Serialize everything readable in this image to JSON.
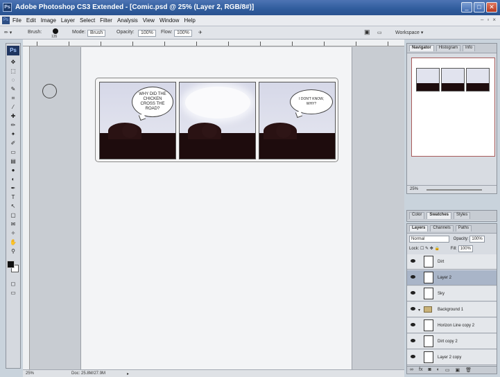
{
  "window": {
    "title": "Adobe Photoshop CS3 Extended - [Comic.psd @ 25% (Layer 2, RGB/8#)]",
    "app_icon": "Ps",
    "controls": [
      "_",
      "□",
      "✕"
    ]
  },
  "menubar": {
    "items": [
      "File",
      "Edit",
      "Image",
      "Layer",
      "Select",
      "Filter",
      "Analysis",
      "View",
      "Window",
      "Help"
    ],
    "doc_controls": [
      "–",
      "▫",
      "×"
    ]
  },
  "options_bar": {
    "brush_label": "Brush:",
    "brush_size": "135",
    "mode_label": "Mode:",
    "mode_value": "Brush",
    "opacity_label": "Opacity:",
    "opacity_value": "100%",
    "flow_label": "Flow:",
    "flow_value": "100%",
    "workspace_label": "Workspace ▾"
  },
  "toolbox": {
    "logo": "Ps",
    "tools": [
      "move-tool",
      "marquee-tool",
      "lasso-tool",
      "quick-select-tool",
      "crop-tool",
      "eyedropper-tool",
      "healing-tool",
      "brush-tool",
      "clone-tool",
      "history-brush-tool",
      "eraser-tool",
      "gradient-tool",
      "blur-tool",
      "dodge-tool",
      "pen-tool",
      "type-tool",
      "path-select-tool",
      "shape-tool",
      "notes-tool",
      "eyedropper-3d-tool",
      "hand-tool",
      "zoom-tool"
    ],
    "glyphs": [
      "✥",
      "⬚",
      "◌",
      "✎",
      "⌗",
      "⁄",
      "✚",
      "✏",
      "✦",
      "✐",
      "▭",
      "▤",
      "●",
      "◐",
      "✒",
      "T",
      "↖",
      "▢",
      "✉",
      "✧",
      "✋",
      "⚲"
    ]
  },
  "comic": {
    "panel1_bubble": "WHY DID THE CHICKEN CROSS THE ROAD?",
    "panel3_bubble": "I DON'T KNOW, WHY?"
  },
  "status_bar": {
    "zoom": "25%",
    "doc_label": "Doc: 25.8M/27.9M",
    "arrow": "▸"
  },
  "navigator": {
    "tabs": [
      "Navigator",
      "Histogram",
      "Info"
    ],
    "zoom": "25%"
  },
  "mid_panel": {
    "tabs": [
      "Color",
      "Swatches",
      "Styles"
    ]
  },
  "layers": {
    "tabs": [
      "Layers",
      "Channels",
      "Paths"
    ],
    "blend_mode": "Normal",
    "opacity_label": "Opacity:",
    "opacity_value": "100%",
    "lock_label": "Lock:",
    "fill_label": "Fill:",
    "fill_value": "100%",
    "rows": [
      {
        "name": "Dirt",
        "type": "layer",
        "selected": false
      },
      {
        "name": "Layer 2",
        "type": "layer",
        "selected": true
      },
      {
        "name": "Sky",
        "type": "layer",
        "selected": false
      },
      {
        "name": "Background 1",
        "type": "group",
        "selected": false
      },
      {
        "name": "Horizon Line copy 2",
        "type": "layer",
        "selected": false
      },
      {
        "name": "Dirt copy 2",
        "type": "layer",
        "selected": false
      },
      {
        "name": "Layer 2 copy",
        "type": "layer",
        "selected": false
      }
    ],
    "bottom_icons": [
      "link-icon",
      "fx-icon",
      "mask-icon",
      "adjustment-icon",
      "group-icon",
      "new-layer-icon",
      "trash-icon"
    ],
    "bottom_glyphs": [
      "∞",
      "fx",
      "◙",
      "◐",
      "▭",
      "▣",
      "🗑"
    ]
  }
}
